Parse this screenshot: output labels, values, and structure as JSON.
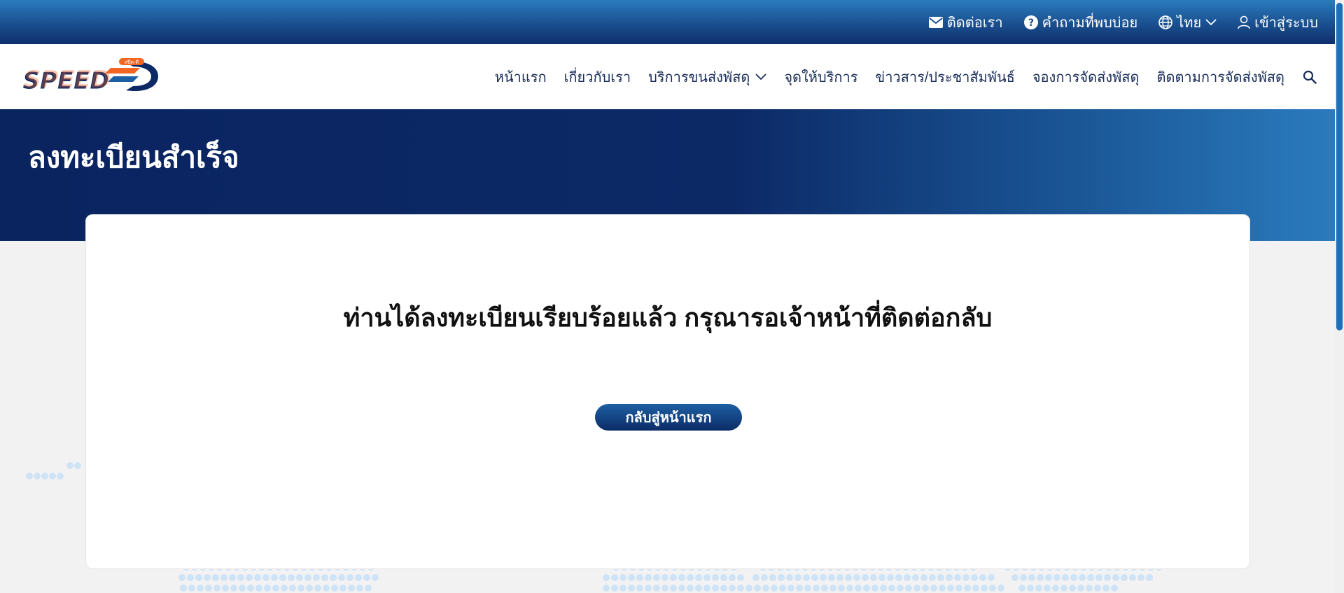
{
  "topbar": {
    "contact_label": "ติดต่อเรา",
    "faq_label": "คำถามที่พบบ่อย",
    "language_label": "ไทย",
    "login_label": "เข้าสู่ระบบ"
  },
  "brand": {
    "logo_text": "SPEED-D",
    "logo_small": "สปีด-ดี"
  },
  "nav": {
    "items": [
      {
        "label": "หน้าแรก"
      },
      {
        "label": "เกี่ยวกับเรา"
      },
      {
        "label": "บริการขนส่งพัสดุ"
      },
      {
        "label": "จุดให้บริการ"
      },
      {
        "label": "ข่าวสาร/ประชาสัมพันธ์"
      },
      {
        "label": "จองการจัดส่งพัสดุ"
      },
      {
        "label": "ติดตามการจัดส่งพัสดุ"
      }
    ]
  },
  "hero": {
    "title": "ลงทะเบียนสำเร็จ"
  },
  "card": {
    "message": "ท่านได้ลงทะเบียนเรียบร้อยแล้ว กรุณารอเจ้าหน้าที่ติดต่อกลับ",
    "button_label": "กลับสู่หน้าแรก"
  },
  "colors": {
    "brand_navy": "#0c2966",
    "brand_blue": "#2a7bbd",
    "logo_orange": "#f26522",
    "dots": "#cfe3f7"
  }
}
